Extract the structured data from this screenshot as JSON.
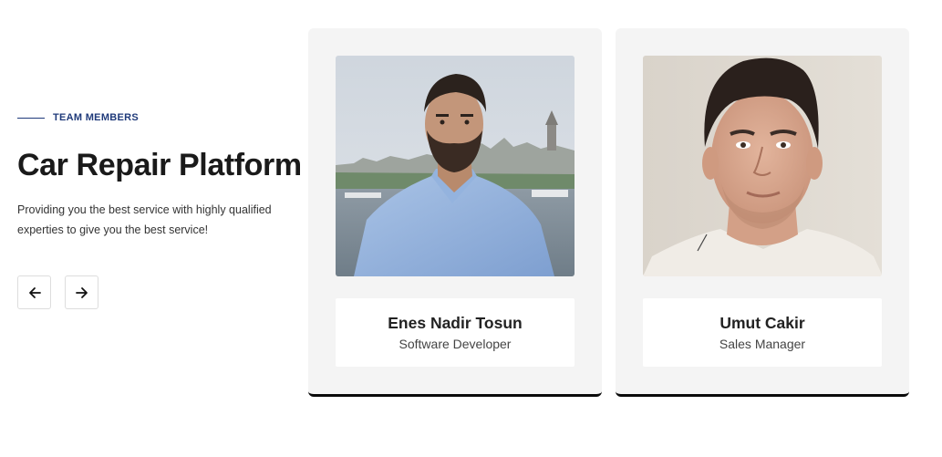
{
  "section": {
    "eyebrow": "TEAM MEMBERS",
    "title": "Car Repair Platform",
    "description": "Providing you the best service with highly qualified experties to give you the best service!"
  },
  "navigation": {
    "prev_icon": "arrow-left-icon",
    "next_icon": "arrow-right-icon"
  },
  "members": [
    {
      "name": "Enes Nadir Tosun",
      "role": "Software Developer",
      "photo_icon": "portrait-photo"
    },
    {
      "name": "Umut Cakir",
      "role": "Sales Manager",
      "photo_icon": "portrait-photo"
    }
  ],
  "colors": {
    "accent": "#1f3a7a",
    "card_background": "#f4f4f4",
    "card_border": "#0a0a0a",
    "title": "#1a1a1a"
  }
}
